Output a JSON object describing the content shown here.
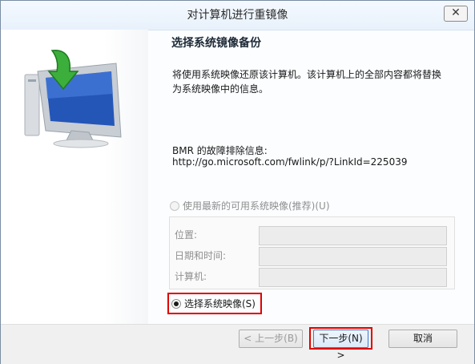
{
  "window": {
    "title": "对计算机进行重镜像",
    "close_glyph": "✕"
  },
  "main": {
    "heading": "选择系统镜像备份",
    "description": "将使用系统映像还原该计算机。该计算机上的全部内容都将替换为系统映像中的信息。",
    "bmr_label": "BMR 的故障排除信息:",
    "bmr_link": "http://go.microsoft.com/fwlink/p/?LinkId=225039",
    "option_latest": "使用最新的可用系统映像(推荐)(U)",
    "fields": {
      "location_label": "位置:",
      "datetime_label": "日期和时间:",
      "computer_label": "计算机:"
    },
    "option_select": "选择系统映像(S)"
  },
  "footer": {
    "back_label": "< 上一步(B)",
    "next_label": "下一步(N) >",
    "cancel_label": "取消"
  },
  "icons": [
    "wizard-computer-icon",
    "restore-arrow-icon",
    "close-icon"
  ],
  "colors": {
    "highlight": "#e00000",
    "arrow_green": "#3cae3c",
    "monitor_blue": "#2456b8"
  }
}
